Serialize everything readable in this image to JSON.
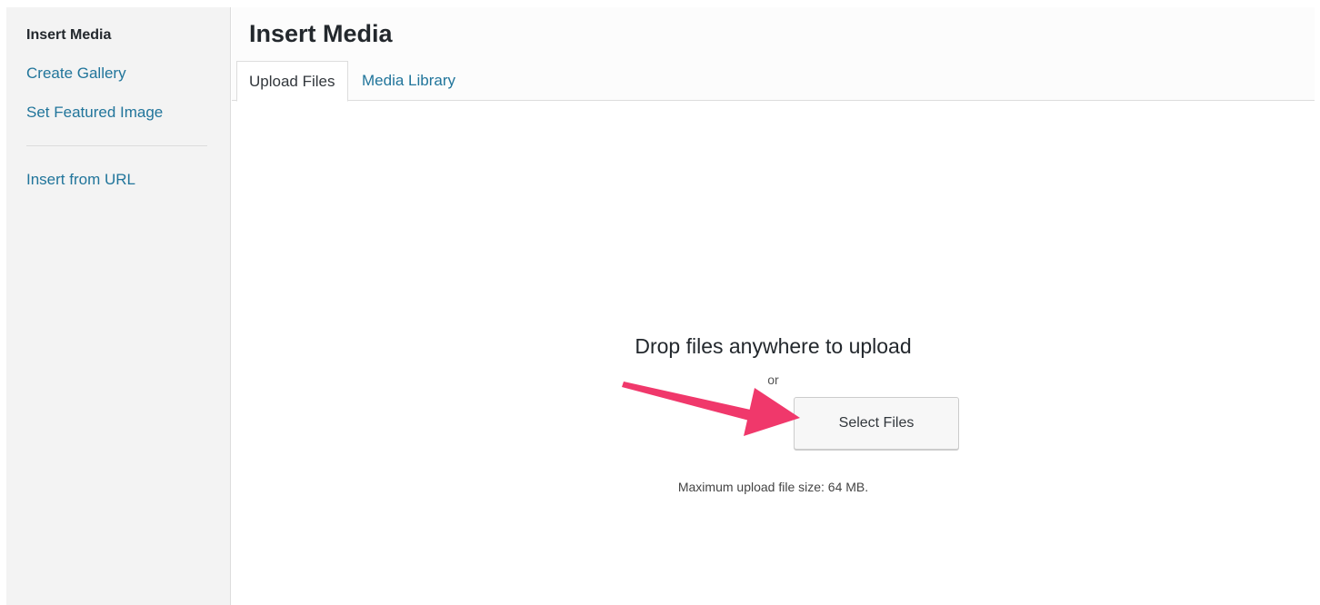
{
  "sidebar": {
    "items": [
      {
        "label": "Insert Media",
        "active": true
      },
      {
        "label": "Create Gallery",
        "active": false
      },
      {
        "label": "Set Featured Image",
        "active": false
      },
      {
        "label": "Insert from URL",
        "active": false
      }
    ]
  },
  "header": {
    "title": "Insert Media",
    "tabs": [
      {
        "label": "Upload Files",
        "active": true
      },
      {
        "label": "Media Library",
        "active": false
      }
    ]
  },
  "uploader": {
    "instructions": "Drop files anywhere to upload",
    "or_text": "or",
    "select_button_label": "Select Files",
    "max_size_text": "Maximum upload file size: 64 MB."
  },
  "annotation": {
    "arrow_color": "#f0386b"
  },
  "colors": {
    "link": "#21759b",
    "sidebar_bg": "#f3f3f3"
  }
}
